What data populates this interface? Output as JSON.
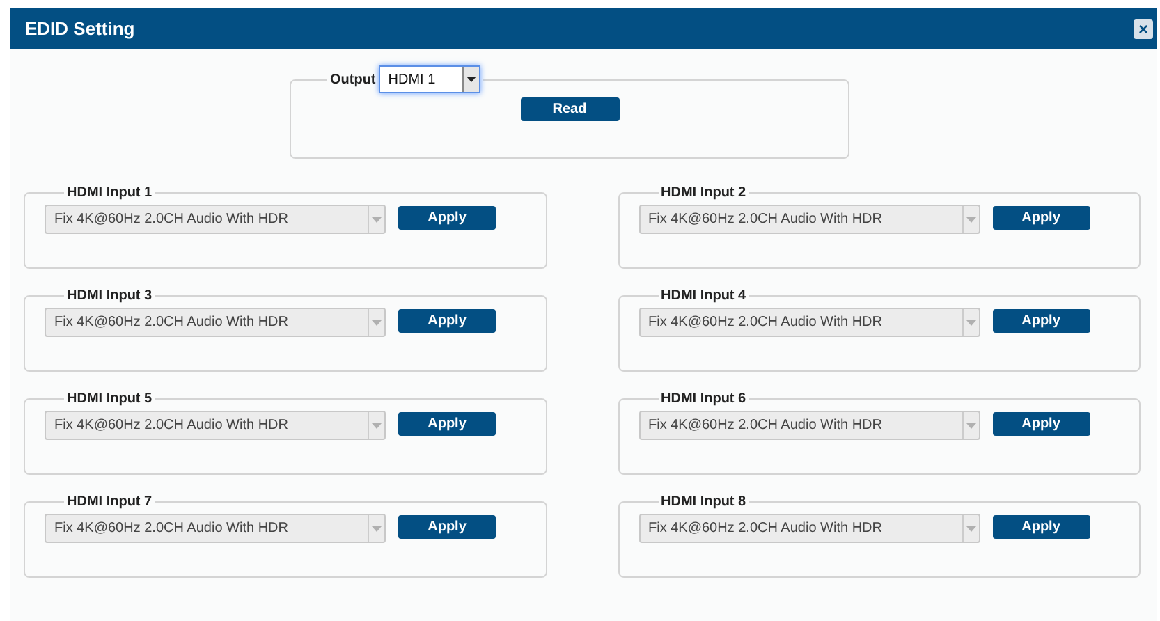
{
  "window": {
    "title": "EDID Setting",
    "close_label": "×"
  },
  "output": {
    "legend": "Output",
    "value": "HDMI 1",
    "focused": true,
    "button": "Read"
  },
  "inputs": [
    {
      "legend": "HDMI Input 1",
      "value": "Fix 4K@60Hz 2.0CH Audio With HDR",
      "disabled": true,
      "button": "Apply"
    },
    {
      "legend": "HDMI Input 2",
      "value": "Fix 4K@60Hz 2.0CH Audio With HDR",
      "disabled": true,
      "button": "Apply"
    },
    {
      "legend": "HDMI Input 3",
      "value": "Fix 4K@60Hz 2.0CH Audio With HDR",
      "disabled": true,
      "button": "Apply"
    },
    {
      "legend": "HDMI Input 4",
      "value": "Fix 4K@60Hz 2.0CH Audio With HDR",
      "disabled": true,
      "button": "Apply"
    },
    {
      "legend": "HDMI Input 5",
      "value": "Fix 4K@60Hz 2.0CH Audio With HDR",
      "disabled": true,
      "button": "Apply"
    },
    {
      "legend": "HDMI Input 6",
      "value": "Fix 4K@60Hz 2.0CH Audio With HDR",
      "disabled": true,
      "button": "Apply"
    },
    {
      "legend": "HDMI Input 7",
      "value": "Fix 4K@60Hz 2.0CH Audio With HDR",
      "disabled": true,
      "button": "Apply"
    },
    {
      "legend": "HDMI Input 8",
      "value": "Fix 4K@60Hz 2.0CH Audio With HDR",
      "disabled": true,
      "button": "Apply"
    }
  ]
}
